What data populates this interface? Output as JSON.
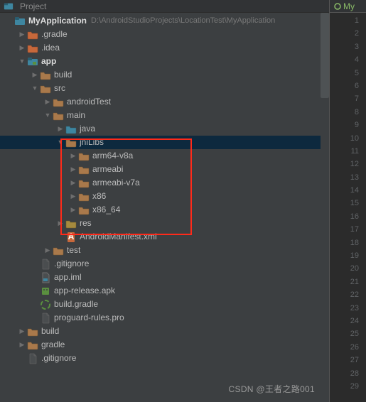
{
  "header": {
    "title": "Project"
  },
  "editorTab": {
    "label": "My"
  },
  "root": {
    "name": "MyApplication",
    "path": "D:\\AndroidStudioProjects\\LocationTest\\MyApplication"
  },
  "tree": [
    {
      "indent": 0,
      "arrow": "blank",
      "icon": "project",
      "label_bind": "root.name",
      "bold": true,
      "path_bind": "root.path"
    },
    {
      "indent": 1,
      "arrow": "right",
      "icon": "folder-orange",
      "label": ".gradle"
    },
    {
      "indent": 1,
      "arrow": "right",
      "icon": "folder-orange",
      "label": ".idea"
    },
    {
      "indent": 1,
      "arrow": "down",
      "icon": "module",
      "label": "app",
      "bold": true
    },
    {
      "indent": 2,
      "arrow": "right",
      "icon": "folder",
      "label": "build"
    },
    {
      "indent": 2,
      "arrow": "down",
      "icon": "folder",
      "label": "src"
    },
    {
      "indent": 3,
      "arrow": "right",
      "icon": "folder",
      "label": "androidTest"
    },
    {
      "indent": 3,
      "arrow": "down",
      "icon": "folder",
      "label": "main"
    },
    {
      "indent": 4,
      "arrow": "right",
      "icon": "source-folder",
      "label": "java"
    },
    {
      "indent": 4,
      "arrow": "down",
      "icon": "folder",
      "label": "jniLibs",
      "selected": true
    },
    {
      "indent": 5,
      "arrow": "right",
      "icon": "folder",
      "label": "arm64-v8a"
    },
    {
      "indent": 5,
      "arrow": "right",
      "icon": "folder",
      "label": "armeabi"
    },
    {
      "indent": 5,
      "arrow": "right",
      "icon": "folder",
      "label": "armeabi-v7a"
    },
    {
      "indent": 5,
      "arrow": "right",
      "icon": "folder",
      "label": "x86"
    },
    {
      "indent": 5,
      "arrow": "right",
      "icon": "folder",
      "label": "x86_64"
    },
    {
      "indent": 4,
      "arrow": "right",
      "icon": "res-folder",
      "label": "res"
    },
    {
      "indent": 4,
      "arrow": "blank",
      "icon": "manifest",
      "label": "AndroidManifest.xml"
    },
    {
      "indent": 3,
      "arrow": "right",
      "icon": "folder",
      "label": "test"
    },
    {
      "indent": 2,
      "arrow": "blank",
      "icon": "file",
      "label": ".gitignore"
    },
    {
      "indent": 2,
      "arrow": "blank",
      "icon": "iml",
      "label": "app.iml"
    },
    {
      "indent": 2,
      "arrow": "blank",
      "icon": "apk",
      "label": "app-release.apk"
    },
    {
      "indent": 2,
      "arrow": "blank",
      "icon": "gradle",
      "label": "build.gradle"
    },
    {
      "indent": 2,
      "arrow": "blank",
      "icon": "file",
      "label": "proguard-rules.pro"
    },
    {
      "indent": 1,
      "arrow": "right",
      "icon": "folder",
      "label": "build"
    },
    {
      "indent": 1,
      "arrow": "right",
      "icon": "folder",
      "label": "gradle"
    },
    {
      "indent": 1,
      "arrow": "blank",
      "icon": "file",
      "label": ".gitignore"
    }
  ],
  "lineNumbers": [
    "1",
    "2",
    "3",
    "4",
    "5",
    "6",
    "7",
    "8",
    "9",
    "10",
    "11",
    "12",
    "13",
    "14",
    "15",
    "16",
    "17",
    "18",
    "19",
    "20",
    "21",
    "22",
    "23",
    "24",
    "25",
    "26",
    "27",
    "28",
    "29"
  ],
  "watermark": "CSDN @王者之路001",
  "icons": {
    "folder": {
      "fill": "#a9794b",
      "stroke": "#755533"
    },
    "folder-orange": {
      "fill": "#c7683b",
      "stroke": "#8a4528"
    },
    "source-folder": {
      "fill": "#3e86a0",
      "stroke": "#2a5d70"
    },
    "res-folder": {
      "fill": "#a58a3e",
      "stroke": "#6e5b28"
    }
  }
}
